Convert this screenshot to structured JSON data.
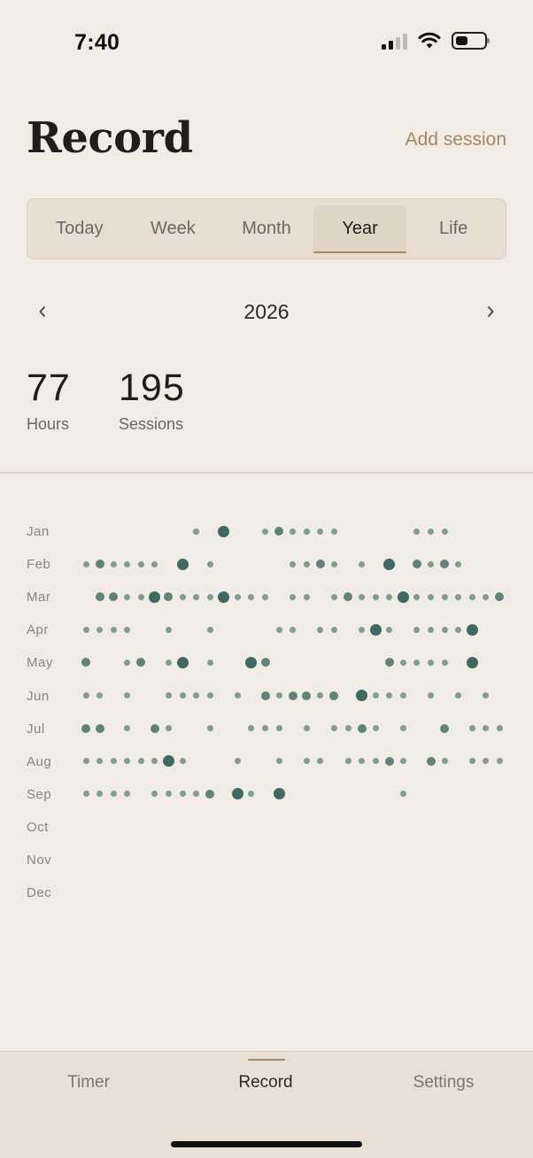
{
  "status": {
    "time": "7:40"
  },
  "header": {
    "title": "Record",
    "add_session": "Add session"
  },
  "segments": [
    {
      "label": "Today",
      "active": false
    },
    {
      "label": "Week",
      "active": false
    },
    {
      "label": "Month",
      "active": false
    },
    {
      "label": "Year",
      "active": true
    },
    {
      "label": "Life",
      "active": false
    }
  ],
  "year_nav": {
    "year": "2026"
  },
  "stats": {
    "hours": {
      "value": "77",
      "label": "Hours"
    },
    "sessions": {
      "value": "195",
      "label": "Sessions"
    }
  },
  "colors": {
    "dot_light": "#7E9D93",
    "dot_dark": "#3E6A63",
    "accent": "#A3875F"
  },
  "calendar": {
    "months": [
      {
        "label": "Jan",
        "days": [
          [
            9,
            1
          ],
          [
            11,
            3
          ],
          [
            14,
            1
          ],
          [
            15,
            2
          ],
          [
            16,
            1
          ],
          [
            17,
            1
          ],
          [
            18,
            1
          ],
          [
            19,
            1
          ],
          [
            25,
            1
          ],
          [
            26,
            1
          ],
          [
            27,
            1
          ]
        ]
      },
      {
        "label": "Feb",
        "days": [
          [
            1,
            1
          ],
          [
            2,
            2
          ],
          [
            3,
            1
          ],
          [
            4,
            1
          ],
          [
            5,
            1
          ],
          [
            6,
            1
          ],
          [
            8,
            3
          ],
          [
            10,
            1
          ],
          [
            16,
            1
          ],
          [
            17,
            1
          ],
          [
            18,
            2
          ],
          [
            19,
            1
          ],
          [
            21,
            1
          ],
          [
            23,
            3
          ],
          [
            25,
            2
          ],
          [
            26,
            1
          ],
          [
            27,
            2
          ],
          [
            28,
            1
          ]
        ]
      },
      {
        "label": "Mar",
        "days": [
          [
            2,
            2
          ],
          [
            3,
            2
          ],
          [
            4,
            1
          ],
          [
            5,
            1
          ],
          [
            6,
            3
          ],
          [
            7,
            2
          ],
          [
            8,
            1
          ],
          [
            9,
            1
          ],
          [
            10,
            1
          ],
          [
            11,
            3
          ],
          [
            12,
            1
          ],
          [
            13,
            1
          ],
          [
            14,
            1
          ],
          [
            16,
            1
          ],
          [
            17,
            1
          ],
          [
            19,
            1
          ],
          [
            20,
            2
          ],
          [
            21,
            1
          ],
          [
            22,
            1
          ],
          [
            23,
            1
          ],
          [
            24,
            3
          ],
          [
            25,
            1
          ],
          [
            26,
            1
          ],
          [
            27,
            1
          ],
          [
            28,
            1
          ],
          [
            29,
            1
          ],
          [
            30,
            1
          ],
          [
            31,
            2
          ]
        ]
      },
      {
        "label": "Apr",
        "days": [
          [
            1,
            1
          ],
          [
            2,
            1
          ],
          [
            3,
            1
          ],
          [
            4,
            1
          ],
          [
            7,
            1
          ],
          [
            10,
            1
          ],
          [
            15,
            1
          ],
          [
            16,
            1
          ],
          [
            18,
            1
          ],
          [
            19,
            1
          ],
          [
            21,
            1
          ],
          [
            22,
            3
          ],
          [
            23,
            1
          ],
          [
            25,
            1
          ],
          [
            26,
            1
          ],
          [
            27,
            1
          ],
          [
            28,
            1
          ],
          [
            29,
            3
          ]
        ]
      },
      {
        "label": "May",
        "days": [
          [
            1,
            2
          ],
          [
            4,
            1
          ],
          [
            5,
            2
          ],
          [
            7,
            1
          ],
          [
            8,
            3
          ],
          [
            10,
            1
          ],
          [
            13,
            3
          ],
          [
            14,
            2
          ],
          [
            23,
            2
          ],
          [
            24,
            1
          ],
          [
            25,
            1
          ],
          [
            26,
            1
          ],
          [
            27,
            1
          ],
          [
            29,
            3
          ]
        ]
      },
      {
        "label": "Jun",
        "days": [
          [
            1,
            1
          ],
          [
            2,
            1
          ],
          [
            4,
            1
          ],
          [
            7,
            1
          ],
          [
            8,
            1
          ],
          [
            9,
            1
          ],
          [
            10,
            1
          ],
          [
            12,
            1
          ],
          [
            14,
            2
          ],
          [
            15,
            1
          ],
          [
            16,
            2
          ],
          [
            17,
            2
          ],
          [
            18,
            1
          ],
          [
            19,
            2
          ],
          [
            21,
            3
          ],
          [
            22,
            1
          ],
          [
            23,
            1
          ],
          [
            24,
            1
          ],
          [
            26,
            1
          ],
          [
            28,
            1
          ],
          [
            30,
            1
          ]
        ]
      },
      {
        "label": "Jul",
        "days": [
          [
            1,
            2
          ],
          [
            2,
            2
          ],
          [
            4,
            1
          ],
          [
            6,
            2
          ],
          [
            7,
            1
          ],
          [
            10,
            1
          ],
          [
            13,
            1
          ],
          [
            14,
            1
          ],
          [
            15,
            1
          ],
          [
            17,
            1
          ],
          [
            19,
            1
          ],
          [
            20,
            1
          ],
          [
            21,
            2
          ],
          [
            22,
            1
          ],
          [
            24,
            1
          ],
          [
            27,
            2
          ],
          [
            29,
            1
          ],
          [
            30,
            1
          ],
          [
            31,
            1
          ]
        ]
      },
      {
        "label": "Aug",
        "days": [
          [
            1,
            1
          ],
          [
            2,
            1
          ],
          [
            3,
            1
          ],
          [
            4,
            1
          ],
          [
            5,
            1
          ],
          [
            6,
            1
          ],
          [
            7,
            3
          ],
          [
            8,
            1
          ],
          [
            12,
            1
          ],
          [
            15,
            1
          ],
          [
            17,
            1
          ],
          [
            18,
            1
          ],
          [
            20,
            1
          ],
          [
            21,
            1
          ],
          [
            22,
            1
          ],
          [
            23,
            2
          ],
          [
            24,
            1
          ],
          [
            26,
            2
          ],
          [
            27,
            1
          ],
          [
            29,
            1
          ],
          [
            30,
            1
          ],
          [
            31,
            1
          ]
        ]
      },
      {
        "label": "Sep",
        "days": [
          [
            1,
            1
          ],
          [
            2,
            1
          ],
          [
            3,
            1
          ],
          [
            4,
            1
          ],
          [
            6,
            1
          ],
          [
            7,
            1
          ],
          [
            8,
            1
          ],
          [
            9,
            1
          ],
          [
            10,
            2
          ],
          [
            12,
            3
          ],
          [
            13,
            1
          ],
          [
            15,
            3
          ],
          [
            24,
            1
          ]
        ]
      },
      {
        "label": "Oct",
        "days": []
      },
      {
        "label": "Nov",
        "days": []
      },
      {
        "label": "Dec",
        "days": []
      }
    ]
  },
  "tabbar": {
    "tabs": [
      {
        "label": "Timer",
        "active": false
      },
      {
        "label": "Record",
        "active": true
      },
      {
        "label": "Settings",
        "active": false
      }
    ]
  }
}
